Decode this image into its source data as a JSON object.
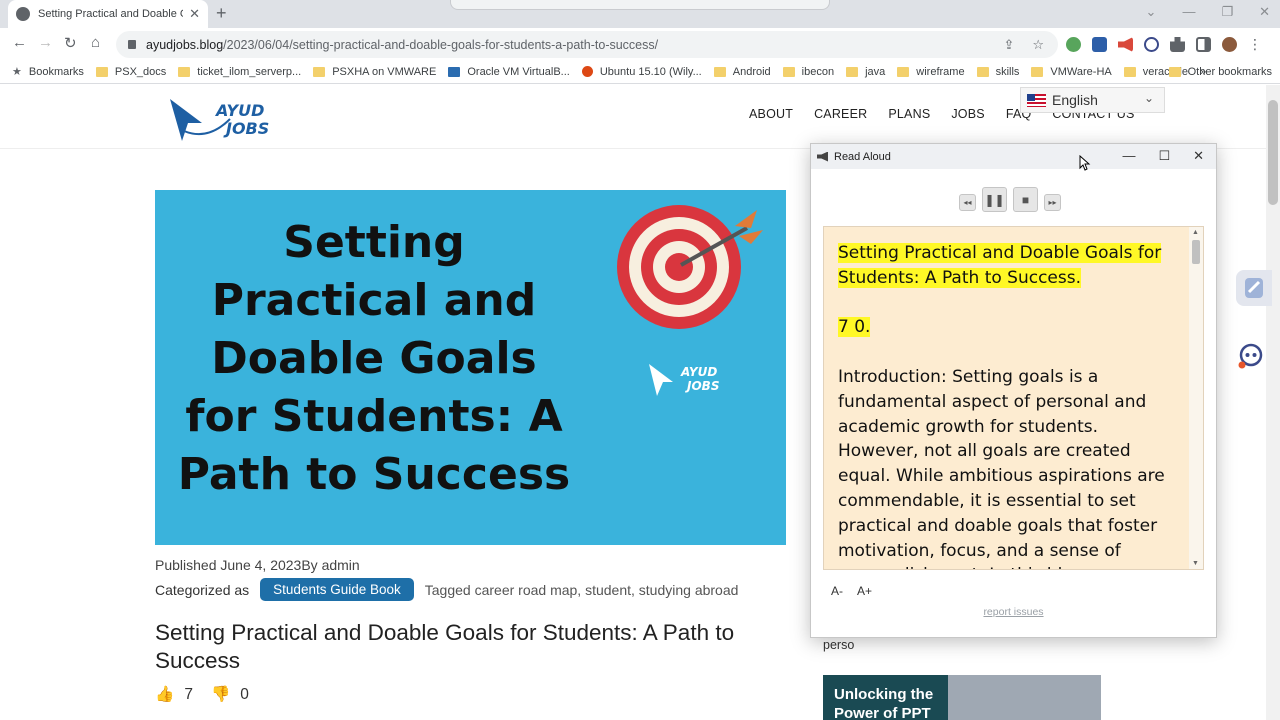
{
  "browser": {
    "tab_title": "Setting Practical and Doable Go",
    "url_host": "ayudjobs.blog",
    "url_path": "/2023/06/04/setting-practical-and-doable-goals-for-students-a-path-to-success/",
    "bookmarks_label": "Bookmarks",
    "bookmarks": [
      {
        "label": "PSX_docs"
      },
      {
        "label": "ticket_ilom_serverp..."
      },
      {
        "label": "PSXHA on VMWARE"
      },
      {
        "label": "Oracle VM VirtualB..."
      },
      {
        "label": "Ubuntu 15.10 (Wily..."
      },
      {
        "label": "Android"
      },
      {
        "label": "ibecon"
      },
      {
        "label": "java"
      },
      {
        "label": "wireframe"
      },
      {
        "label": "skills"
      },
      {
        "label": "VMWare-HA"
      },
      {
        "label": "veracode"
      }
    ],
    "bookmarks_more": "»",
    "other_bookmarks": "Other bookmarks"
  },
  "site": {
    "logo_line1": "AYUD",
    "logo_line2": "JOBS",
    "nav": [
      "ABOUT",
      "CAREER",
      "PLANS",
      "JOBS",
      "FAQ",
      "CONTACT US"
    ],
    "language": "English",
    "hero_title": "Setting Practical and Doable Goals for Students: A Path to Success",
    "hero_logo_line1": "AYUD",
    "hero_logo_line2": "JOBS",
    "published": "Published June 4, 2023By admin",
    "categorized_label": "Categorized as",
    "category": "Students Guide Book",
    "tagged": "Tagged career road map, student, studying abroad",
    "post_title": "Setting Practical and Doable Goals for Students: A Path to Success",
    "likes": "7",
    "dislikes": "0",
    "sidebar_text": "perso",
    "sidebar_card_line1": "Unlocking the",
    "sidebar_card_line2": "Power of PPT"
  },
  "read_aloud": {
    "title": "Read Aloud",
    "heading": "Setting Practical and Doable Goals for Students: A Path to Success.",
    "votes_line": "7 0.",
    "intro": "Introduction: Setting goals is a fundamental aspect of personal and academic growth for students. However, not all goals are created equal. While ambitious aspirations are commendable, it is essential to set practical and doable goals that foster motivation, focus, and a sense of accomplishment. In this blog",
    "font_smaller": "A-",
    "font_larger": "A+",
    "report": "report issues"
  },
  "colors": {
    "hero_bg": "#3ab3dc",
    "category_badge": "#1e6fa8",
    "highlight": "#fff826",
    "read_bg": "#fdecd1"
  }
}
